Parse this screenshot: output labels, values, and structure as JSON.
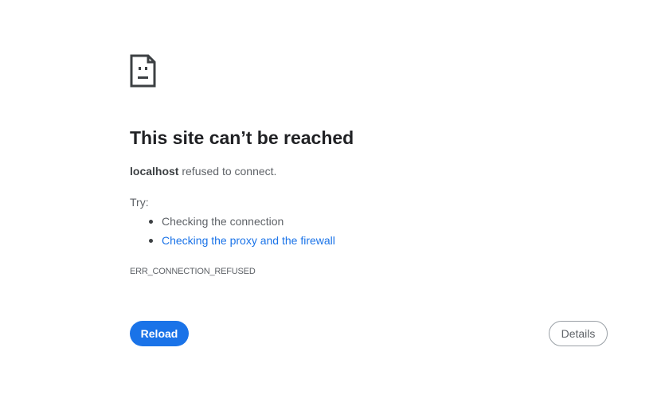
{
  "error": {
    "icon": "sad-document-icon",
    "title": "This site can’t be reached",
    "host": "localhost",
    "message": " refused to connect.",
    "try_label": "Try:",
    "suggestions": [
      {
        "label": "Checking the connection",
        "is_link": false
      },
      {
        "label": "Checking the proxy and the firewall",
        "is_link": true
      }
    ],
    "code": "ERR_CONNECTION_REFUSED"
  },
  "buttons": {
    "reload_label": "Reload",
    "details_label": "Details"
  },
  "colors": {
    "accent": "#1a73e8",
    "title": "#202124",
    "body_text": "#5f6368"
  }
}
